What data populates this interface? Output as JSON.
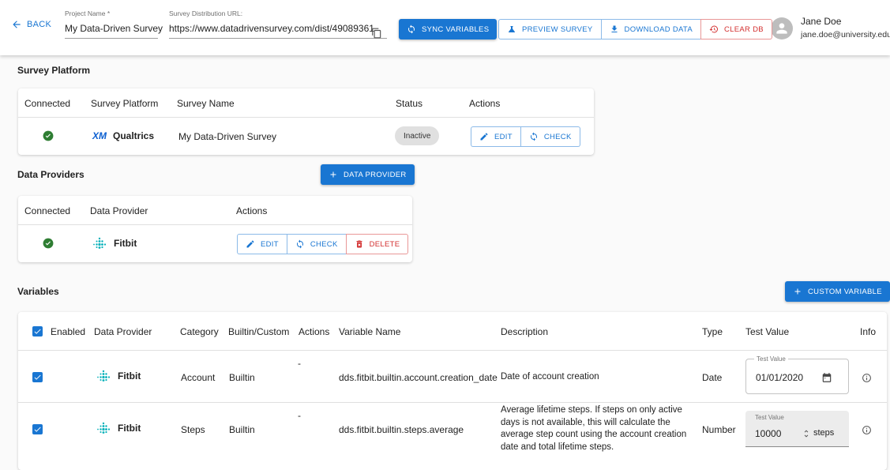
{
  "header": {
    "back_label": "BACK",
    "project_name_label": "Project Name *",
    "project_name_value": "My Data-Driven Survey",
    "survey_url_label": "Survey Distribution URL:",
    "survey_url_value": "https://www.datadrivensurvey.com/dist/49089361",
    "sync_label": "SYNC VARIABLES",
    "preview_label": "PREVIEW SURVEY",
    "download_label": "DOWNLOAD DATA",
    "clear_label": "CLEAR DB",
    "user_name": "Jane Doe",
    "user_email": "jane.doe@university.edu"
  },
  "survey_platform": {
    "title": "Survey Platform",
    "columns": [
      "Connected",
      "Survey Platform",
      "Survey Name",
      "Status",
      "Actions"
    ],
    "row": {
      "platform_logo": "XM",
      "platform_name": "Qualtrics",
      "survey_name": "My Data-Driven Survey",
      "status": "Inactive",
      "edit_label": "EDIT",
      "check_label": "CHECK"
    }
  },
  "data_providers": {
    "title": "Data Providers",
    "add_label": "DATA PROVIDER",
    "columns": [
      "Connected",
      "Data Provider",
      "Actions"
    ],
    "row": {
      "provider_name": "Fitbit",
      "edit_label": "EDIT",
      "check_label": "CHECK",
      "delete_label": "DELETE"
    }
  },
  "variables": {
    "title": "Variables",
    "add_label": "CUSTOM VARIABLE",
    "columns": [
      "Enabled",
      "Data Provider",
      "Category",
      "Builtin/Custom",
      "Actions",
      "Variable Name",
      "Description",
      "Type",
      "Test Value",
      "Info"
    ],
    "rows": [
      {
        "provider": "Fitbit",
        "category": "Account",
        "kind": "Builtin",
        "actions": "-",
        "name": "dds.fitbit.builtin.account.creation_date",
        "description": "Date of account creation",
        "type": "Date",
        "test_label": "Test Value",
        "test_value": "01/01/2020"
      },
      {
        "provider": "Fitbit",
        "category": "Steps",
        "kind": "Builtin",
        "actions": "-",
        "name": "dds.fitbit.builtin.steps.average",
        "description": "Average lifetime steps. If steps on only active days is not available, this will calculate the average step count using the account creation date and total lifetime steps.",
        "type": "Number",
        "test_label": "Test Value",
        "test_value": "10000",
        "test_unit": "steps"
      }
    ]
  },
  "colors": {
    "primary": "#1976d2",
    "danger": "#d32f2f",
    "success": "#2e7d32",
    "fitbit": "#00b0b9"
  }
}
